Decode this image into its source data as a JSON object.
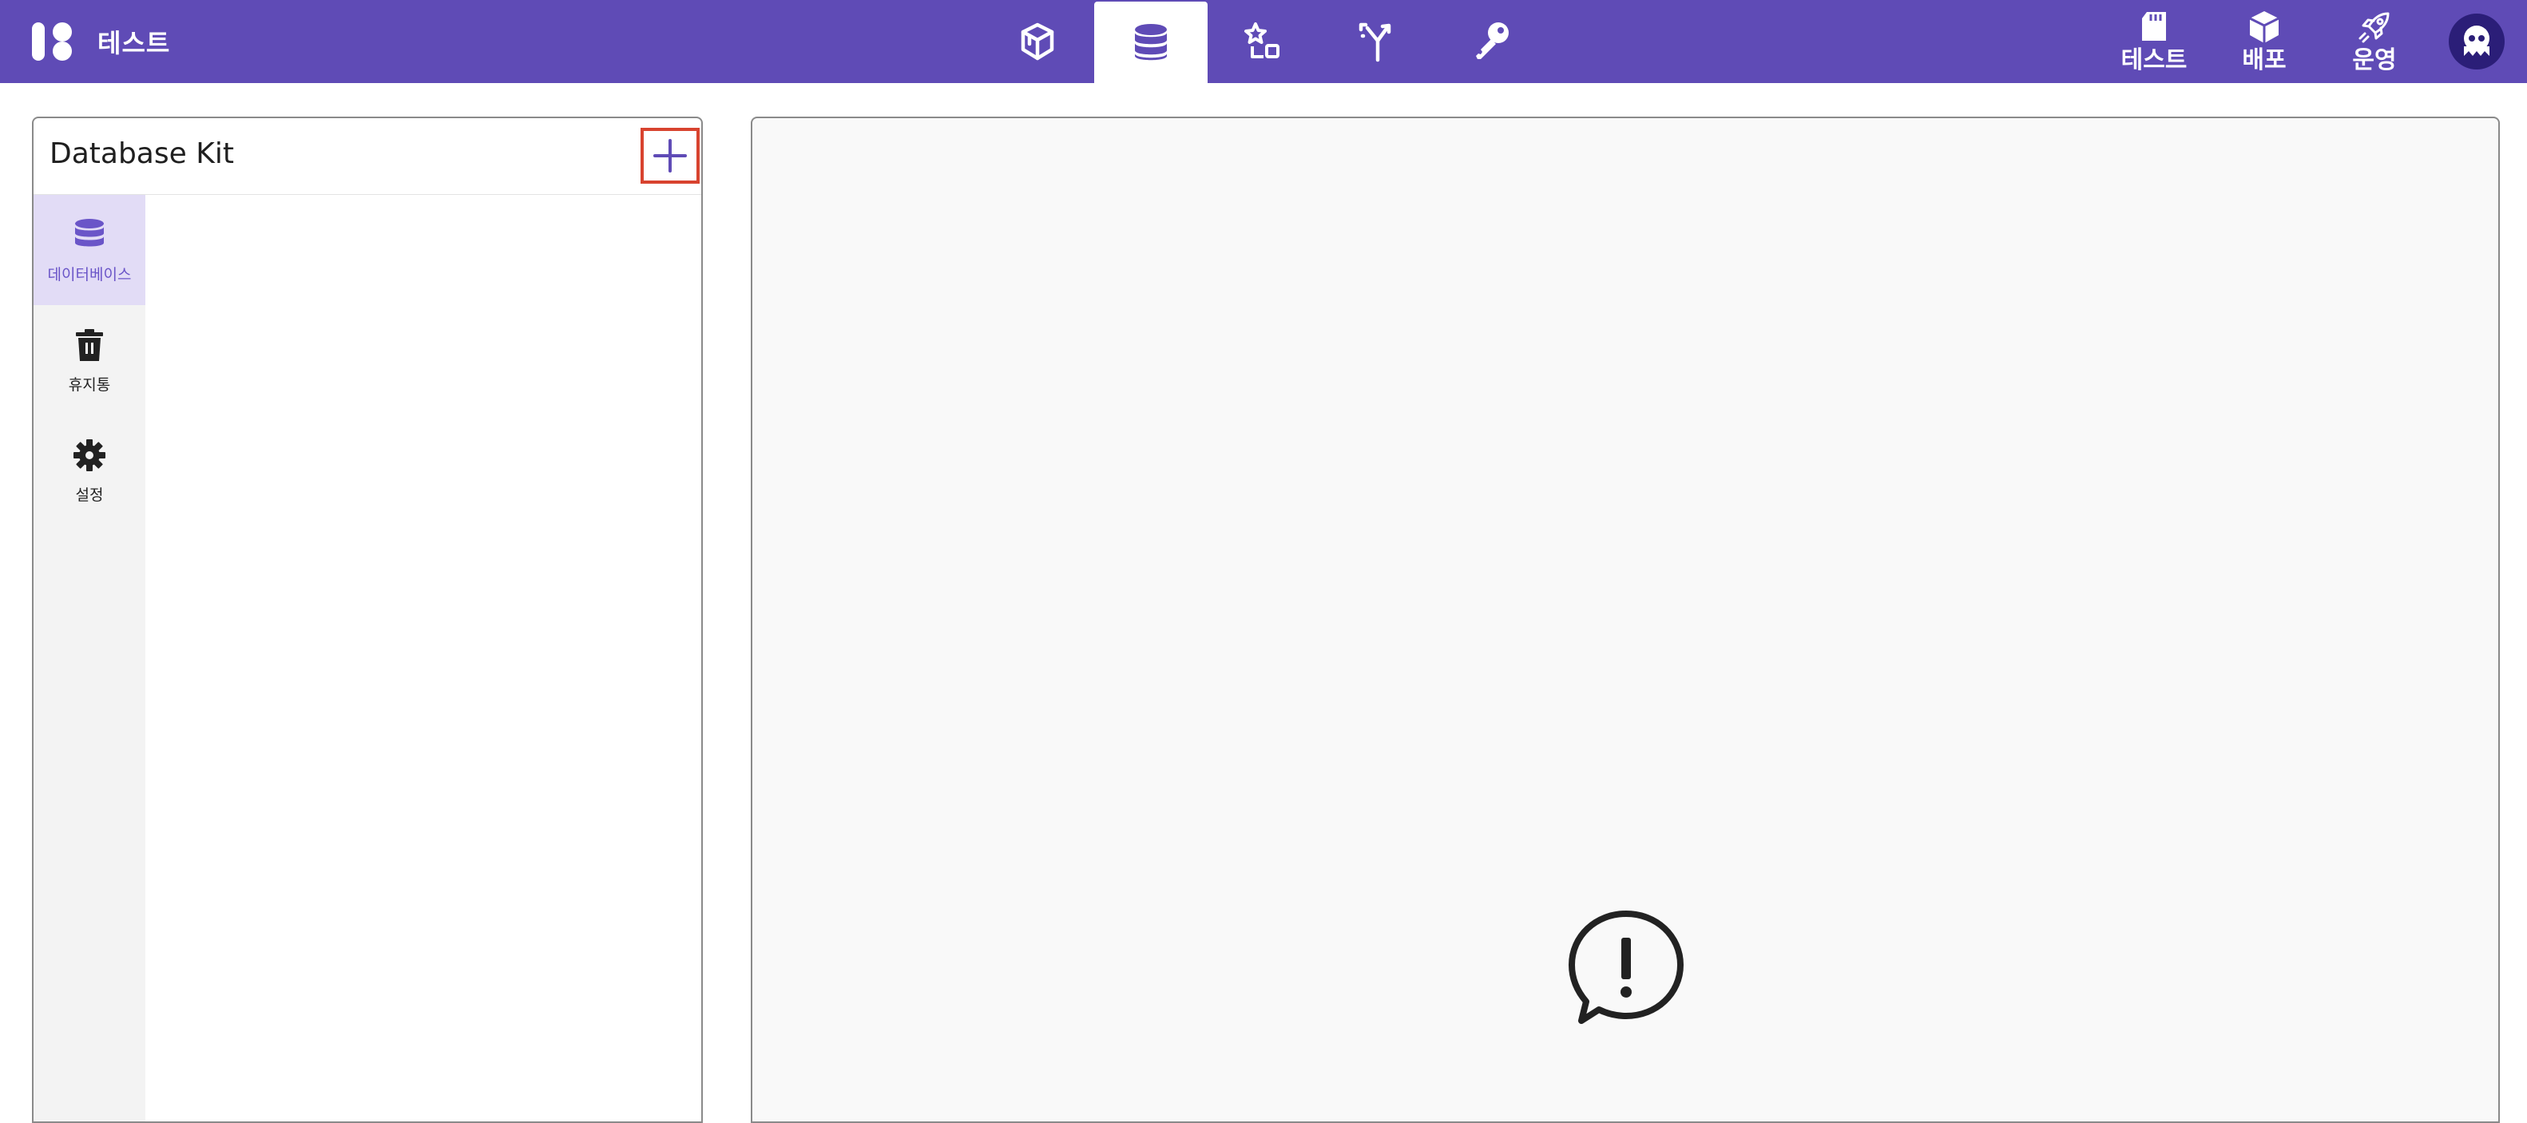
{
  "app": {
    "project_name": "테스트"
  },
  "top_nav": {
    "tabs": [
      {
        "icon": "cube-icon",
        "active": false
      },
      {
        "icon": "database-icon",
        "active": true
      },
      {
        "icon": "shapes-icon",
        "active": false
      },
      {
        "icon": "branch-arrows-icon",
        "active": false
      },
      {
        "icon": "key-icon",
        "active": false
      }
    ],
    "right_items": [
      {
        "icon": "sd-card-icon",
        "label": "테스트"
      },
      {
        "icon": "package-icon",
        "label": "배포"
      },
      {
        "icon": "rocket-icon",
        "label": "운영"
      }
    ]
  },
  "left_panel": {
    "title": "Database Kit",
    "add_icon": "plus-icon",
    "nav": [
      {
        "icon": "database-icon",
        "label": "데이터베이스",
        "active": true
      },
      {
        "icon": "trash-icon",
        "label": "휴지통",
        "active": false
      },
      {
        "icon": "gear-icon",
        "label": "설정",
        "active": false
      }
    ]
  },
  "content": {
    "empty_state_icon": "alert-speech-bubble-icon"
  },
  "colors": {
    "topbar": "#5f4bb6",
    "accent": "#6a55c8",
    "active_nav_bg": "#e2dcf6",
    "highlight_box": "#d8432f",
    "content_bg": "#f9f9f9"
  }
}
